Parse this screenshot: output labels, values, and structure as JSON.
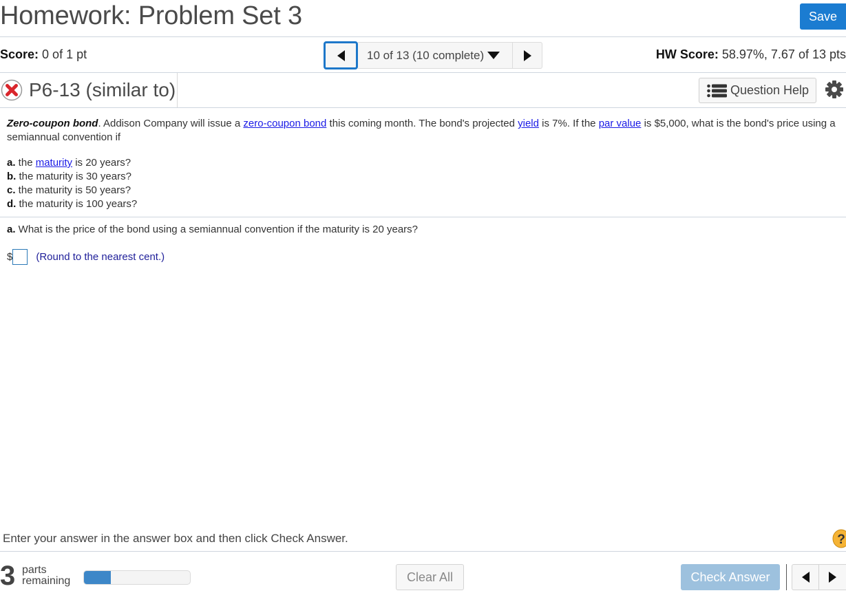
{
  "header": {
    "title": "Homework: Problem Set 3",
    "save_label": "Save"
  },
  "scorebar": {
    "score_label": "Score:",
    "score_value": "0 of 1 pt",
    "question_nav": "10 of 13 (10 complete)",
    "hw_score_label": "HW Score:",
    "hw_score_value": "58.97%, 7.67 of 13 pts"
  },
  "question_bar": {
    "status_icon": "incorrect-x-icon",
    "question_id": "P6-13 (similar to)",
    "help_label": "Question Help",
    "help_icon": "list-icon",
    "settings_icon": "gear-icon"
  },
  "problem": {
    "title": "Zero-coupon bond",
    "intro_1": ". Addison Company will issue a ",
    "link_zero_coupon": "zero-coupon bond",
    "intro_2": " this coming month. The bond's projected ",
    "link_yield": "yield",
    "intro_3": " is 7%. If the ",
    "link_par_value": "par value",
    "intro_4": " is $5,000, what is the bond's price using a semiannual convention if",
    "parts": [
      {
        "letter": "a.",
        "pre": " the ",
        "link": "maturity",
        "post": " is 20 years?"
      },
      {
        "letter": "b.",
        "text": " the maturity is 30 years?"
      },
      {
        "letter": "c.",
        "text": " the maturity is 50 years?"
      },
      {
        "letter": "d.",
        "text": " the maturity is 100 years?"
      }
    ]
  },
  "current_question": {
    "letter": "a.",
    "text": " What is the price of the bond using a semiannual convention if the maturity is 20 years?",
    "currency": "$",
    "answer_value": "",
    "hint": "(Round to the nearest cent.)"
  },
  "footer": {
    "instructions": "Enter your answer in the answer box and then click Check Answer.",
    "parts_remaining_count": "3",
    "parts_remaining_label_1": "parts",
    "parts_remaining_label_2": "remaining",
    "progress_fraction": 0.25,
    "clear_all_label": "Clear All",
    "check_answer_label": "Check Answer"
  },
  "colors": {
    "primary": "#1b7cd1",
    "check_disabled": "#9dc1de",
    "incorrect": "#d9262c",
    "link": "#1a1ae6",
    "progress": "#3d87c8"
  }
}
